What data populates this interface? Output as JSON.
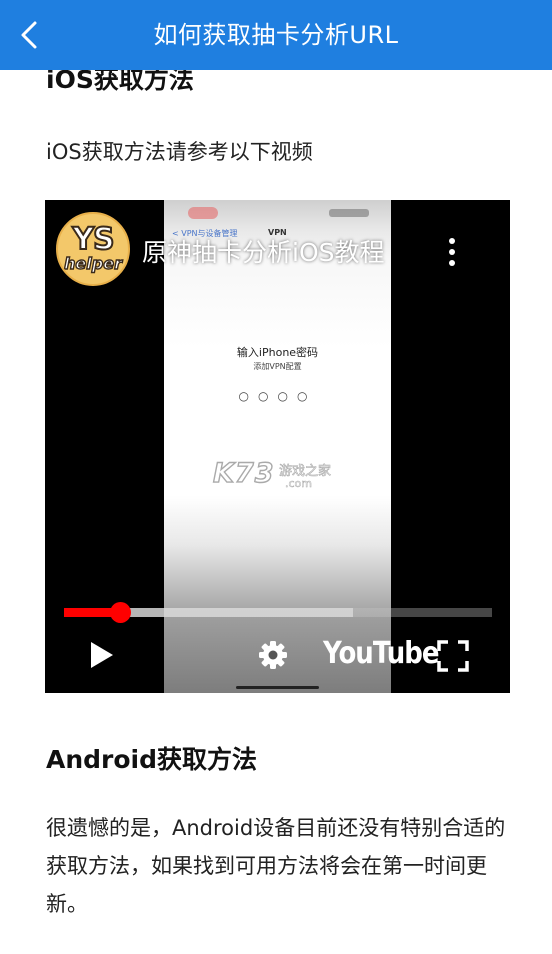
{
  "header": {
    "title": "如何获取抽卡分析URL",
    "back_icon": "chevron-left-icon",
    "background_color": "#1f7fe0"
  },
  "ios_section": {
    "heading": "iOS获取方法",
    "description": "iOS获取方法请参考以下视频"
  },
  "video": {
    "title": "原神抽卡分析iOS教程",
    "channel_avatar_text_top": "YS",
    "channel_avatar_text_bottom": "helper",
    "phone_nav_text": "< VPN与设备管理",
    "phone_nav_vpn": "VPN",
    "password_prompt": "输入iPhone密码",
    "password_sub": "添加VPN配置",
    "password_dots": "○○○○",
    "watermark_main": "K73",
    "watermark_cn": "游戏之家",
    "watermark_domain": ".com",
    "progress_played_fraction": 0.13,
    "progress_buffered_fraction": 0.675,
    "youtube_label": "YouTube",
    "progress_color": "#ff0000"
  },
  "android_section": {
    "heading": "Android获取方法",
    "description": "很遗憾的是，Android设备目前还没有特别合适的获取方法，如果找到可用方法将会在第一时间更新。"
  }
}
